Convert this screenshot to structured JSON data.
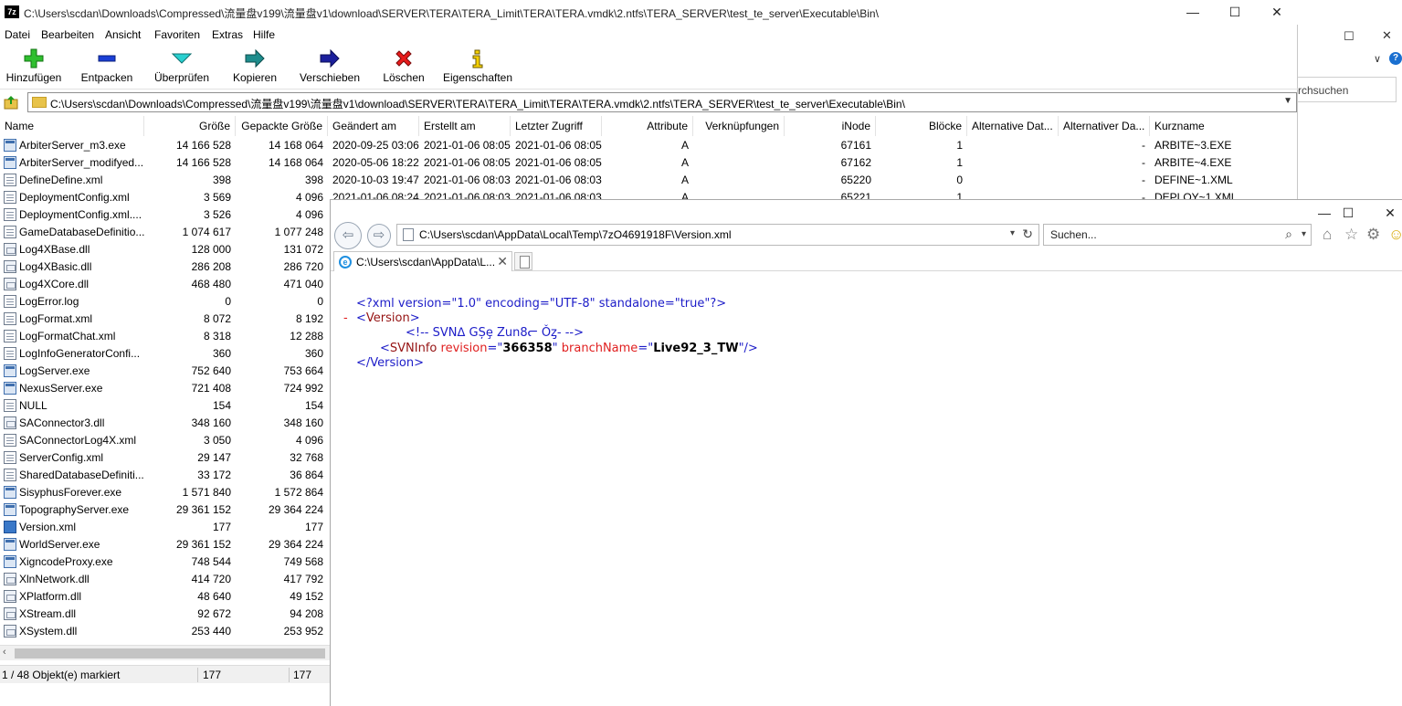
{
  "bg_window": {
    "search_text": "rchsuchen",
    "minimize": "—",
    "maximize": "☐",
    "close": "✕",
    "dropdown": "∨",
    "help": "?"
  },
  "zip": {
    "title": "C:\\Users\\scdan\\Downloads\\Compressed\\流量盘v199\\流量盘v1\\download\\SERVER\\TERA\\TERA_Limit\\TERA\\TERA.vmdk\\2.ntfs\\TERA_SERVER\\test_te_server\\Executable\\Bin\\",
    "app_icon": "7z",
    "minimize": "—",
    "maximize": "☐",
    "close": "✕",
    "menu": [
      "Datei",
      "Bearbeiten",
      "Ansicht",
      "Favoriten",
      "Extras",
      "Hilfe"
    ],
    "toolbar": {
      "add": "Hinzufügen",
      "extract": "Entpacken",
      "test": "Überprüfen",
      "copy": "Kopieren",
      "move": "Verschieben",
      "delete": "Löschen",
      "info": "Eigenschaften"
    },
    "address": "C:\\Users\\scdan\\Downloads\\Compressed\\流量盘v199\\流量盘v1\\download\\SERVER\\TERA\\TERA_Limit\\TERA\\TERA.vmdk\\2.ntfs\\TERA_SERVER\\test_te_server\\Executable\\Bin\\",
    "columns": [
      "Name",
      "Größe",
      "Gepackte Größe",
      "Geändert am",
      "Erstellt am",
      "Letzter Zugriff",
      "Attribute",
      "Verknüpfungen",
      "iNode",
      "Blöcke",
      "Alternative Dat...",
      "Alternativer Da...",
      "Kurzname"
    ],
    "rows_full": [
      [
        "ArbiterServer_m3.exe",
        "14 166 528",
        "14 168 064",
        "2020-09-25 03:06",
        "2021-01-06 08:05",
        "2021-01-06 08:05",
        "A",
        "",
        "67161",
        "1",
        "",
        "-",
        "ARBITE~3.EXE"
      ],
      [
        "ArbiterServer_modifyed...",
        "14 166 528",
        "14 168 064",
        "2020-05-06 18:22",
        "2021-01-06 08:05",
        "2021-01-06 08:05",
        "A",
        "",
        "67162",
        "1",
        "",
        "-",
        "ARBITE~4.EXE"
      ],
      [
        "DefineDefine.xml",
        "398",
        "398",
        "2020-10-03 19:47",
        "2021-01-06 08:03",
        "2021-01-06 08:03",
        "A",
        "",
        "65220",
        "0",
        "",
        "-",
        "DEFINE~1.XML"
      ],
      [
        "DeploymentConfig.xml",
        "3 569",
        "4 096",
        "2021-01-06 08:24",
        "2021-01-06 08:03",
        "2021-01-06 08:03",
        "A",
        "",
        "65221",
        "1",
        "",
        "-",
        "DEPLOY~1.XML"
      ]
    ],
    "rows": [
      {
        "name": "ArbiterServer_m3.exe",
        "size": "14 166 528",
        "packed": "14 168 064",
        "icon": "exe"
      },
      {
        "name": "ArbiterServer_modifyed...",
        "size": "14 166 528",
        "packed": "14 168 064",
        "icon": "exe"
      },
      {
        "name": "DefineDefine.xml",
        "size": "398",
        "packed": "398",
        "icon": "xml"
      },
      {
        "name": "DeploymentConfig.xml",
        "size": "3 569",
        "packed": "4 096",
        "icon": "xml"
      },
      {
        "name": "DeploymentConfig.xml....",
        "size": "3 526",
        "packed": "4 096",
        "icon": "xml"
      },
      {
        "name": "GameDatabaseDefinitio...",
        "size": "1 074 617",
        "packed": "1 077 248",
        "icon": "xml"
      },
      {
        "name": "Log4XBase.dll",
        "size": "128 000",
        "packed": "131 072",
        "icon": "dll"
      },
      {
        "name": "Log4XBasic.dll",
        "size": "286 208",
        "packed": "286 720",
        "icon": "dll"
      },
      {
        "name": "Log4XCore.dll",
        "size": "468 480",
        "packed": "471 040",
        "icon": "dll"
      },
      {
        "name": "LogError.log",
        "size": "0",
        "packed": "0",
        "icon": "xml"
      },
      {
        "name": "LogFormat.xml",
        "size": "8 072",
        "packed": "8 192",
        "icon": "xml"
      },
      {
        "name": "LogFormatChat.xml",
        "size": "8 318",
        "packed": "12 288",
        "icon": "xml"
      },
      {
        "name": "LogInfoGeneratorConfi...",
        "size": "360",
        "packed": "360",
        "icon": "xml"
      },
      {
        "name": "LogServer.exe",
        "size": "752 640",
        "packed": "753 664",
        "icon": "exe"
      },
      {
        "name": "NexusServer.exe",
        "size": "721 408",
        "packed": "724 992",
        "icon": "exe"
      },
      {
        "name": "NULL",
        "size": "154",
        "packed": "154",
        "icon": "xml"
      },
      {
        "name": "SAConnector3.dll",
        "size": "348 160",
        "packed": "348 160",
        "icon": "dll"
      },
      {
        "name": "SAConnectorLog4X.xml",
        "size": "3 050",
        "packed": "4 096",
        "icon": "xml"
      },
      {
        "name": "ServerConfig.xml",
        "size": "29 147",
        "packed": "32 768",
        "icon": "xml"
      },
      {
        "name": "SharedDatabaseDefiniti...",
        "size": "33 172",
        "packed": "36 864",
        "icon": "xml"
      },
      {
        "name": "SisyphusForever.exe",
        "size": "1 571 840",
        "packed": "1 572 864",
        "icon": "exe"
      },
      {
        "name": "TopographyServer.exe",
        "size": "29 361 152",
        "packed": "29 364 224",
        "icon": "exe"
      },
      {
        "name": "Version.xml",
        "size": "177",
        "packed": "177",
        "icon": "sel"
      },
      {
        "name": "WorldServer.exe",
        "size": "29 361 152",
        "packed": "29 364 224",
        "icon": "exe"
      },
      {
        "name": "XigncodeProxy.exe",
        "size": "748 544",
        "packed": "749 568",
        "icon": "exe"
      },
      {
        "name": "XlnNetwork.dll",
        "size": "414 720",
        "packed": "417 792",
        "icon": "dll"
      },
      {
        "name": "XPlatform.dll",
        "size": "48 640",
        "packed": "49 152",
        "icon": "dll"
      },
      {
        "name": "XStream.dll",
        "size": "92 672",
        "packed": "94 208",
        "icon": "dll"
      },
      {
        "name": "XSystem.dll",
        "size": "253 440",
        "packed": "253 952",
        "icon": "dll"
      }
    ],
    "status": {
      "selection": "1 / 48 Objekt(e) markiert",
      "size": "177",
      "packed": "177"
    },
    "scroll_left": "‹"
  },
  "ie": {
    "minimize": "—",
    "maximize": "☐",
    "close": "✕",
    "back": "⇦",
    "forward": "⇨",
    "url": "C:\\Users\\scdan\\AppData\\Local\\Temp\\7zO4691918F\\Version.xml",
    "url_dropdown": "▾",
    "refresh": "↻",
    "search_placeholder": "Suchen...",
    "search_icon": "⌕",
    "search_dropdown": "▾",
    "home": "⌂",
    "star": "☆",
    "gear": "⚙",
    "smiley": "☺",
    "tab_title": "C:\\Users\\scdan\\AppData\\L...",
    "tab_close": "✕",
    "tab_icon": "e",
    "xml": {
      "decl": "<?xml version=\"1.0\" encoding=\"UTF-8\" standalone=\"true\"?>",
      "minus": "-",
      "open_bracket": "<",
      "root_tag": "Version",
      "close_bracket": ">",
      "comment": "<!-- SVNᐃ GȘȩ Zun8ᓕ Ǒȥ- -->",
      "svn_tag": "SVNInfo",
      "attr1_name": "revision",
      "eq_quote": "=\"",
      "attr1_value": "366358",
      "quote_space": "\"",
      "attr2_name": "branchName",
      "attr2_value": "Live92_3_TW",
      "self_close": "\"/>",
      "root_close": "</Version>"
    }
  }
}
